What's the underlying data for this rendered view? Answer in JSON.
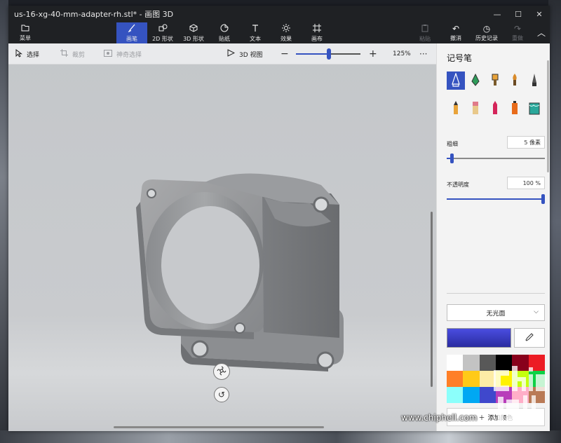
{
  "window": {
    "title": "us-16-xg-40-mm-adapter-rh.stl* - 画图 3D",
    "controls": {
      "minimize": "—",
      "maximize": "☐",
      "close": "✕"
    }
  },
  "ribbon": {
    "menu": {
      "label": "菜单",
      "icon": "folder-icon"
    },
    "tools": [
      {
        "label": "画笔",
        "icon": "brush-icon",
        "active": true
      },
      {
        "label": "2D 形状",
        "icon": "2d-shapes-icon"
      },
      {
        "label": "3D 形状",
        "icon": "3d-shapes-icon"
      },
      {
        "label": "贴纸",
        "icon": "sticker-icon"
      },
      {
        "label": "文本",
        "icon": "text-icon"
      },
      {
        "label": "效果",
        "icon": "effects-icon"
      },
      {
        "label": "画布",
        "icon": "canvas-icon"
      }
    ],
    "right": [
      {
        "label": "粘贴",
        "icon": "paste-icon",
        "disabled": true
      },
      {
        "label": "撤消",
        "icon": "undo-icon"
      },
      {
        "label": "历史记录",
        "icon": "history-icon"
      },
      {
        "label": "重做",
        "icon": "redo-icon",
        "disabled": true
      }
    ],
    "collapse": "︿"
  },
  "canvas_toolbar": {
    "select": "选择",
    "crop": "裁剪",
    "magic_select": "神奇选择",
    "view3d": "3D 视图",
    "zoom_minus": "−",
    "zoom_plus": "+",
    "zoom_level": "125%",
    "zoom_fraction": 0.5,
    "more": "···"
  },
  "panel": {
    "title": "记号笔",
    "brushes": [
      {
        "name": "marker",
        "color": "#3553c0"
      },
      {
        "name": "calligraphy-pen",
        "color": "#2e9c5a"
      },
      {
        "name": "oil-brush",
        "color": "#e8a33a"
      },
      {
        "name": "watercolor",
        "color": "#d88a2a"
      },
      {
        "name": "pixel-pen",
        "color": "#444"
      },
      {
        "name": "pencil",
        "color": "#e8a33a"
      },
      {
        "name": "eraser",
        "color": "#e07a8a"
      },
      {
        "name": "crayon",
        "color": "#d4245a"
      },
      {
        "name": "spray-can",
        "color": "#e86b1a"
      },
      {
        "name": "fill",
        "color": "#2aa79a"
      }
    ],
    "thickness": {
      "label": "粗细",
      "value": "5 像素",
      "fraction": 0.05
    },
    "opacity": {
      "label": "不透明度",
      "value": "100 %",
      "fraction": 1.0
    },
    "finish": {
      "value": "无光面"
    },
    "current_color": "#3a3cc6",
    "palette": [
      "#ffffff",
      "#c3c3c3",
      "#585858",
      "#000000",
      "#88001b",
      "#ec1c24",
      "#ff7f27",
      "#ffca18",
      "#fdeca6",
      "#fff200",
      "#c4ff0e",
      "#0ed145",
      "#8cfffb",
      "#00a8f3",
      "#3f48cc",
      "#b83dba",
      "#ffaec8",
      "#b97a56"
    ],
    "add_color": "添加颜色"
  },
  "watermark": "www.chiphell.com"
}
